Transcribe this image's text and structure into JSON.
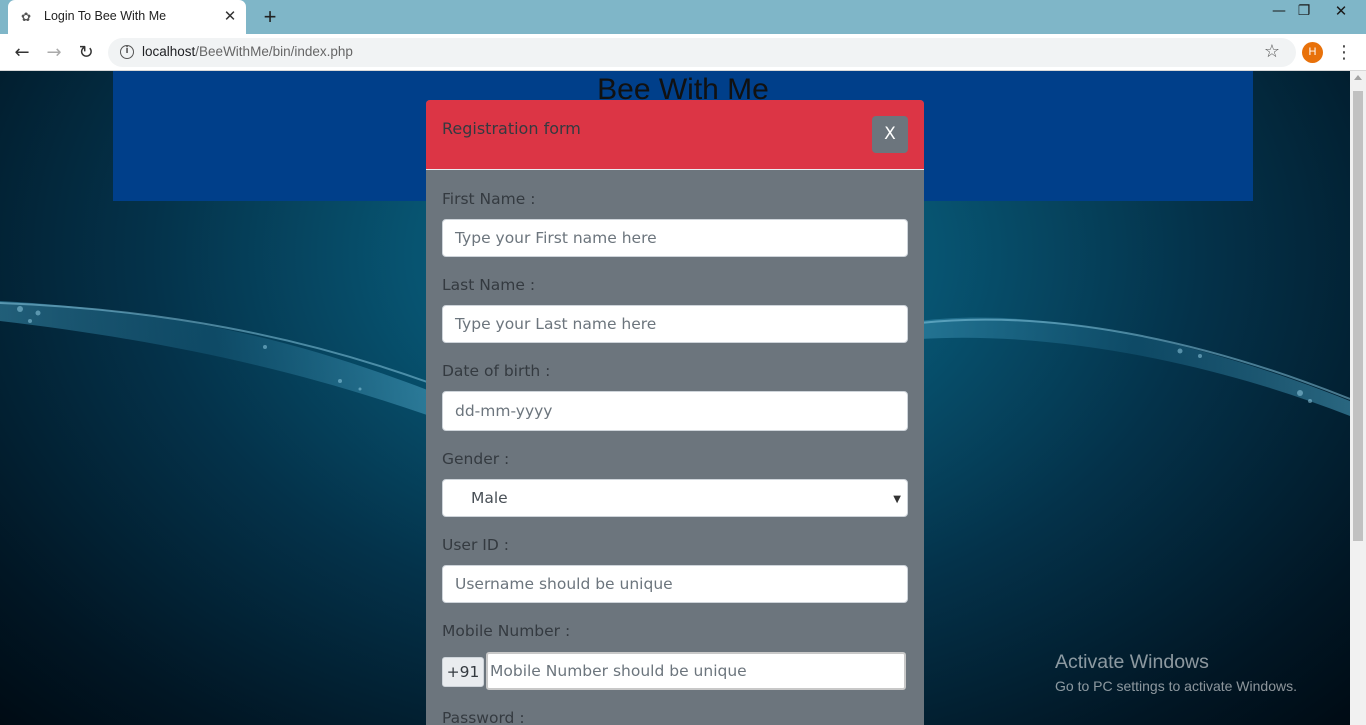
{
  "browser": {
    "tab_title": "Login To Bee With Me",
    "tab_close": "✕",
    "new_tab": "+",
    "url_host": "localhost",
    "url_path": "/BeeWithMe/bin/index.php",
    "profile_initial": "H",
    "minimize": "—",
    "maximize": "❐",
    "close": "✕"
  },
  "page": {
    "site_title": "Bee With Me"
  },
  "modal": {
    "title": "Registration form",
    "close_label": "X",
    "fields": {
      "first_name": {
        "label": "First Name :",
        "placeholder": "Type your First name here"
      },
      "last_name": {
        "label": "Last Name :",
        "placeholder": "Type your Last name here"
      },
      "dob": {
        "label": "Date of birth :",
        "placeholder": "dd-mm-yyyy"
      },
      "gender": {
        "label": "Gender :",
        "value": "Male"
      },
      "user_id": {
        "label": "User ID :",
        "placeholder": "Username should be unique"
      },
      "mobile": {
        "label": "Mobile Number :",
        "prefix": "+91",
        "placeholder": "Mobile Number should be unique"
      },
      "password": {
        "label": "Password :"
      }
    }
  },
  "watermark": {
    "title": "Activate Windows",
    "subtitle": "Go to PC settings to activate Windows."
  },
  "colors": {
    "header_red": "#dc3545",
    "modal_gray": "#6c757d",
    "banner_blue": "#003f8a"
  }
}
